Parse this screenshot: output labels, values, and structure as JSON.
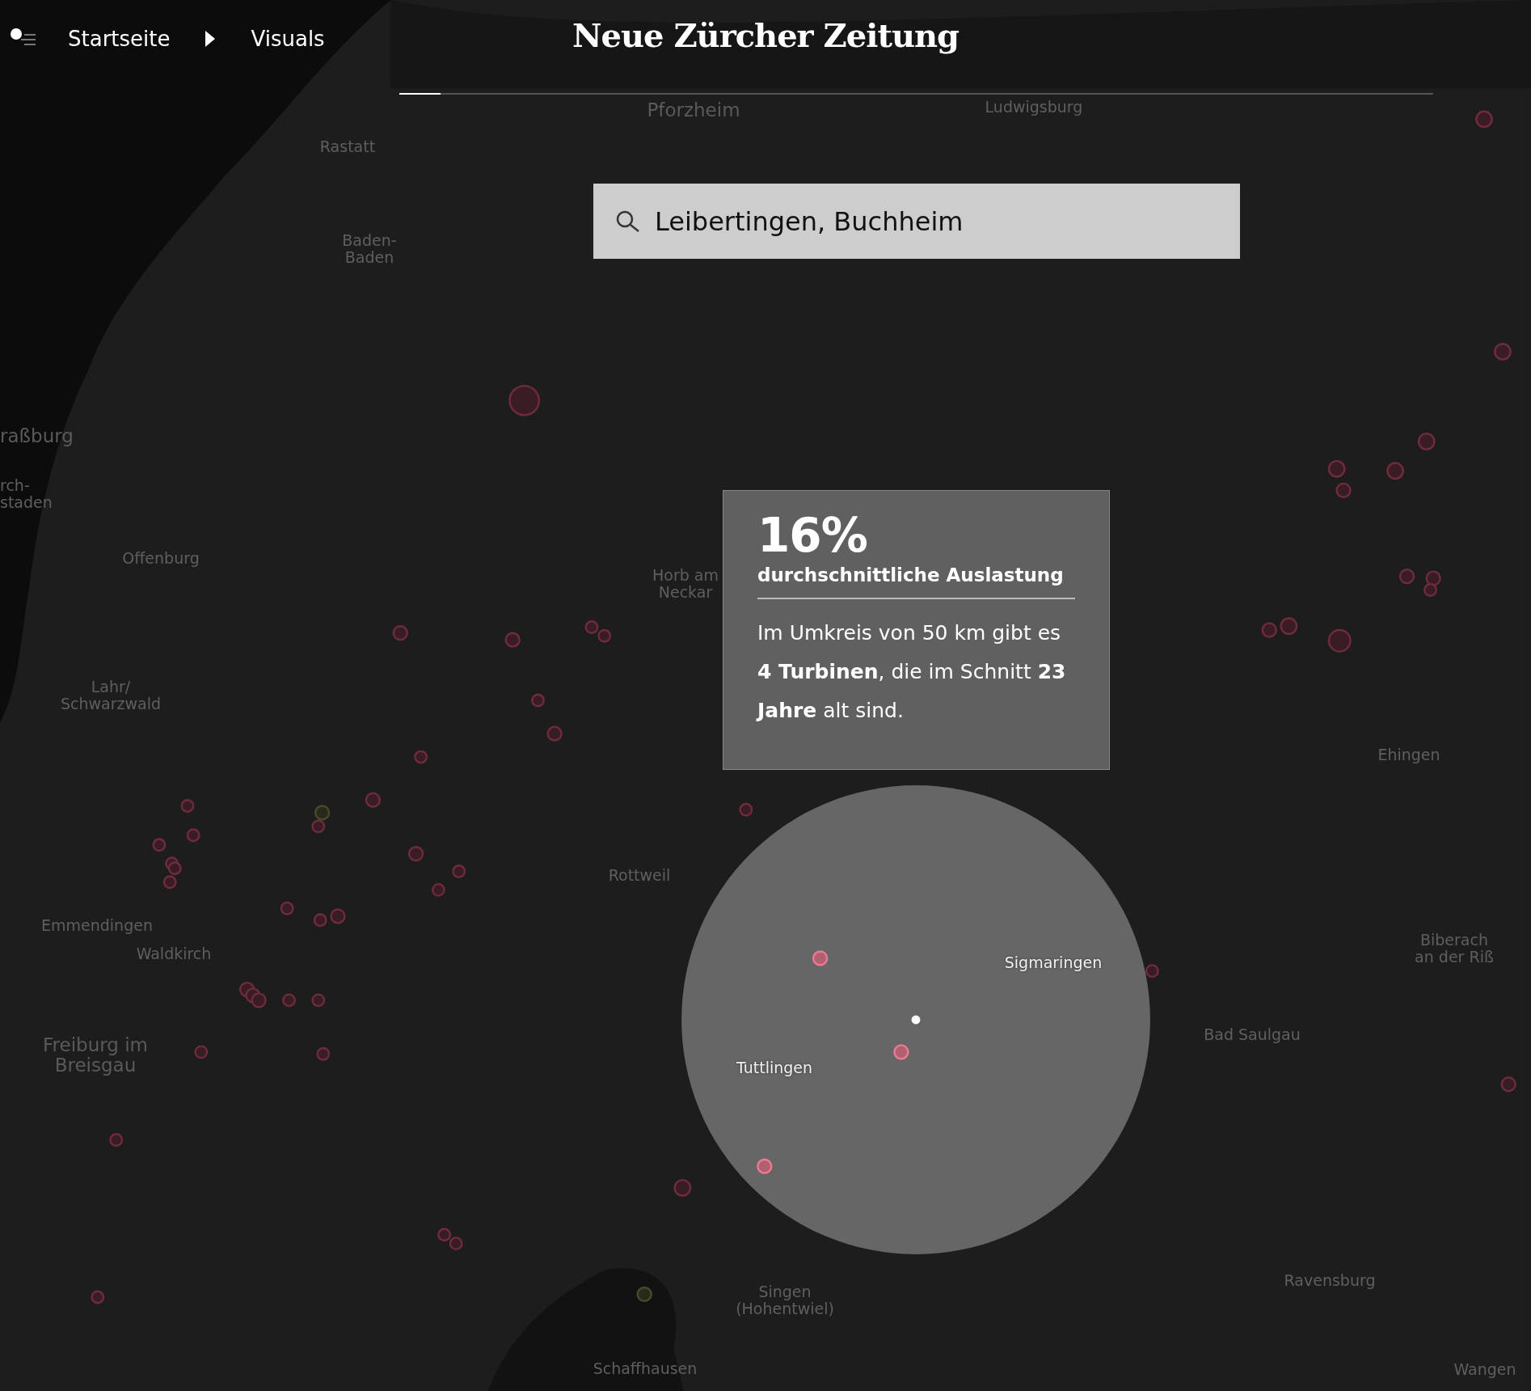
{
  "header": {
    "breadcrumb": [
      {
        "label": "Startseite"
      },
      {
        "label": "Visuals"
      }
    ],
    "logo": "Neue Zürcher Zeitung",
    "progress": {
      "level": 0.04
    }
  },
  "search": {
    "value": "Leibertingen, Buchheim"
  },
  "tooltip": {
    "value": "16%",
    "label": "durchschnittliche Auslastung",
    "text": "Im Umkreis von 50 km gibt es **4 Turbinen**, die im Schnitt **23 Jahre** alt sind."
  },
  "map": {
    "labels": [
      {
        "text": "Pforzheim",
        "kind": "city"
      },
      {
        "text": "Ludwigsburg",
        "kind": "town"
      },
      {
        "text": "Rastatt",
        "kind": "town"
      },
      {
        "text": "Baden-\nBaden",
        "kind": "town"
      },
      {
        "text": "raßburg",
        "kind": "city"
      },
      {
        "text": "rch-\nstaden",
        "kind": "town"
      },
      {
        "text": "Offenburg",
        "kind": "town"
      },
      {
        "text": "Horb am\nNeckar",
        "kind": "town"
      },
      {
        "text": "Lahr/\nSchwarzwald",
        "kind": "town"
      },
      {
        "text": "Ehingen",
        "kind": "town"
      },
      {
        "text": "Rottweil",
        "kind": "town"
      },
      {
        "text": "Emmendingen",
        "kind": "town"
      },
      {
        "text": "Waldkirch",
        "kind": "town"
      },
      {
        "text": "Biberach\nan der Riß",
        "kind": "town"
      },
      {
        "text": "Sigmaringen",
        "kind": "highlight"
      },
      {
        "text": "Freiburg im\nBreisgau",
        "kind": "city"
      },
      {
        "text": "Bad Saulgau",
        "kind": "town"
      },
      {
        "text": "Tuttlingen",
        "kind": "highlight"
      },
      {
        "text": "Ravensburg",
        "kind": "town"
      },
      {
        "text": "Singen\n(Hohentwiel)",
        "kind": "town"
      },
      {
        "text": "Schaffhausen",
        "kind": "town"
      },
      {
        "text": "Wangen",
        "kind": "town"
      }
    ]
  }
}
